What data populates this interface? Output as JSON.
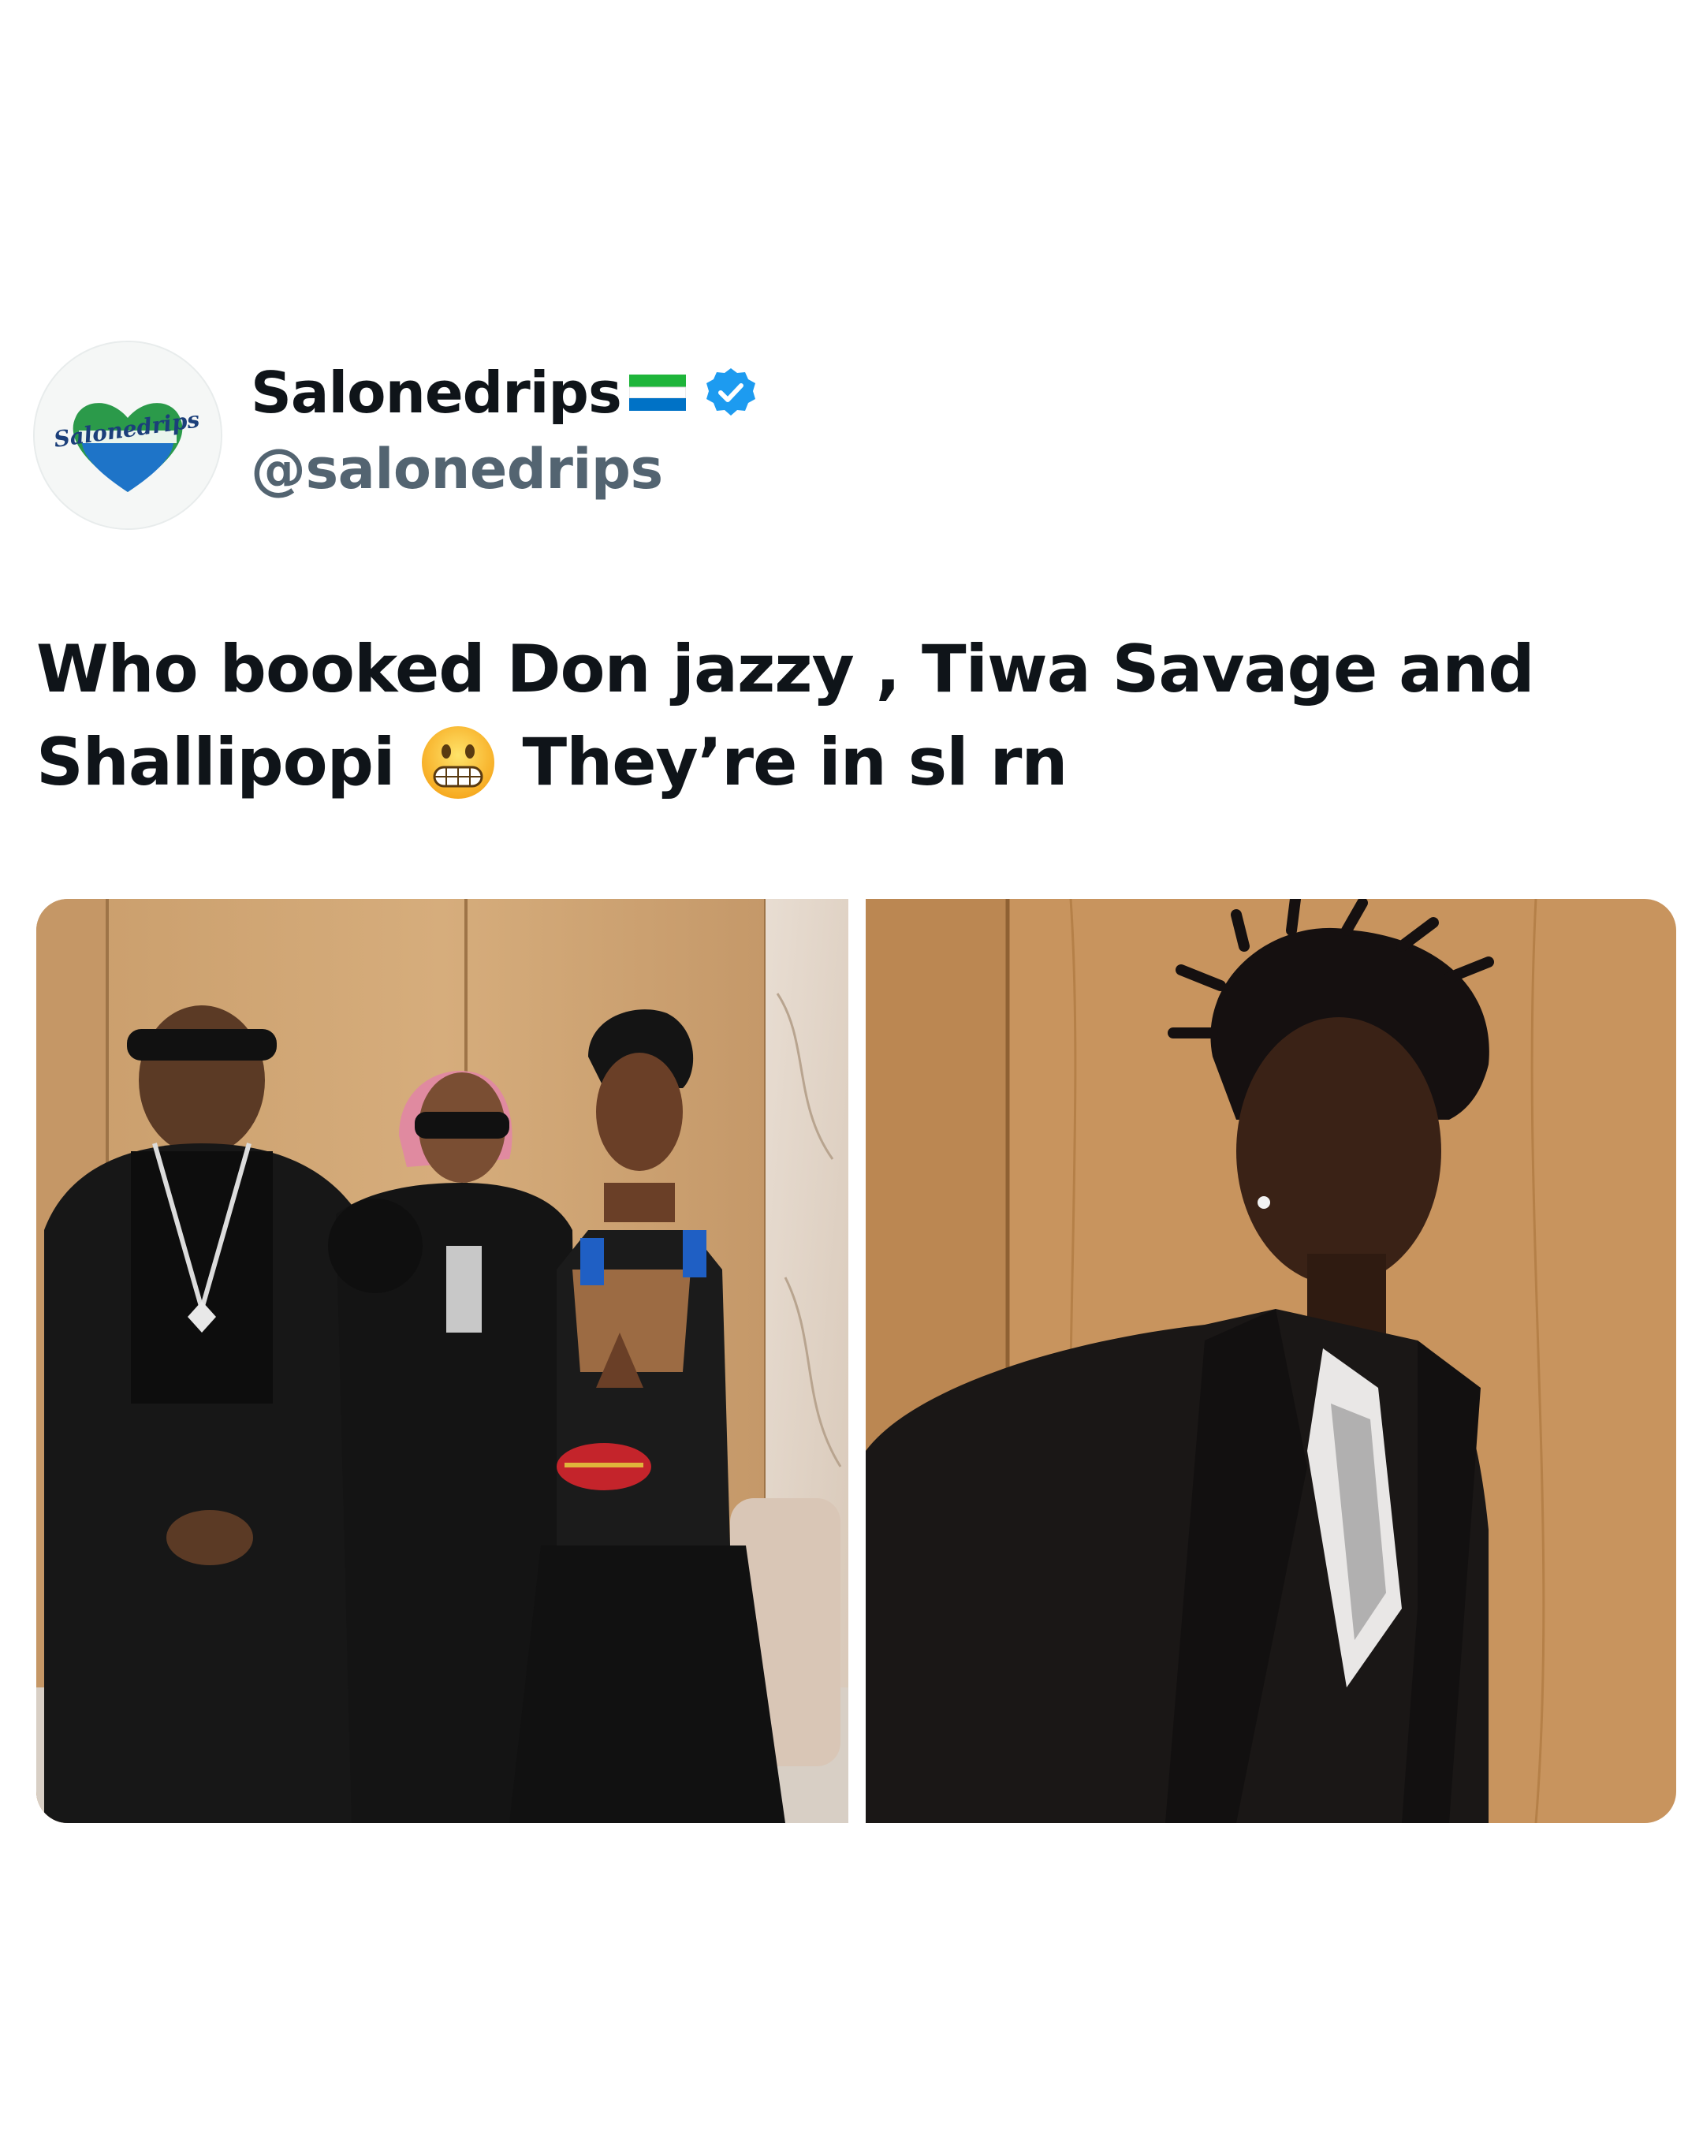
{
  "tweet": {
    "author": {
      "display_name": "Salonedrips",
      "handle": "@salonedrips",
      "flag_icon": "sierra-leone-flag-icon",
      "verified_icon": "verified-badge-icon",
      "avatar_logo_text": "Salonedrips"
    },
    "text": {
      "line1": "Who booked Don jazzy , Tiwa Savage and",
      "line2_start": "Shallipopi",
      "emoji": "grimacing-face-emoji",
      "line2_end": "They’re in sl rn"
    },
    "media": [
      {
        "name": "group-photo",
        "description_icon": "photo"
      },
      {
        "name": "portrait-photo",
        "description_icon": "photo"
      }
    ]
  },
  "colors": {
    "text_primary": "#0f1419",
    "text_secondary": "#536471",
    "verified_blue": "#1d9bf0",
    "flag_green": "#1eb53a",
    "flag_white": "#ffffff",
    "flag_blue": "#0072c6"
  }
}
